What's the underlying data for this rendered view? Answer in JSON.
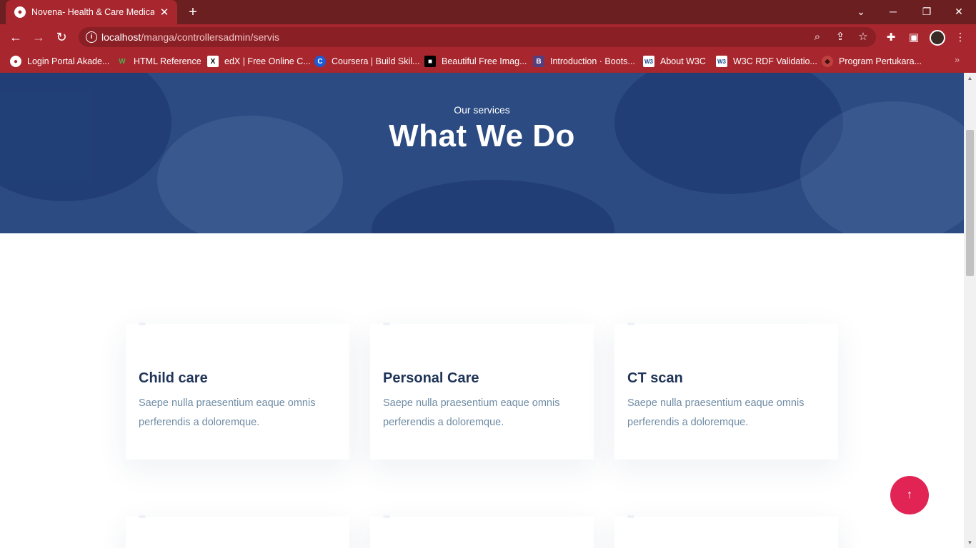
{
  "browser": {
    "tab_title": "Novena- Health & Care Medical t",
    "url_host": "localhost",
    "url_path": "/manga/controllersadmin/servis",
    "bookmarks": [
      {
        "label": "Login Portal Akade...",
        "icon": "portal-icon"
      },
      {
        "label": "HTML Reference",
        "icon": "w-icon"
      },
      {
        "label": "edX | Free Online C...",
        "icon": "edx-icon"
      },
      {
        "label": "Coursera | Build Skil...",
        "icon": "coursera-icon"
      },
      {
        "label": "Beautiful Free Imag...",
        "icon": "unsplash-icon"
      },
      {
        "label": "Introduction · Boots...",
        "icon": "bootstrap-icon"
      },
      {
        "label": "About W3C",
        "icon": "w3c-icon"
      },
      {
        "label": "W3C RDF Validatio...",
        "icon": "w3c-icon"
      },
      {
        "label": "Program Pertukara...",
        "icon": "program-icon"
      }
    ]
  },
  "hero": {
    "subtitle": "Our services",
    "title": "What We Do"
  },
  "services": [
    {
      "title": "Child care",
      "text": "Saepe nulla praesentium eaque omnis perferendis a doloremque."
    },
    {
      "title": "Personal Care",
      "text": "Saepe nulla praesentium eaque omnis perferendis a doloremque."
    },
    {
      "title": "CT scan",
      "text": "Saepe nulla praesentium eaque omnis perferendis a doloremque."
    }
  ],
  "back_to_top": {
    "icon": "arrow-up-icon",
    "glyph": "↑"
  },
  "colors": {
    "chrome_dark": "#6b1f20",
    "chrome": "#a8262d",
    "hero_bg": "#2b4b82",
    "heading": "#1f3458",
    "body_text": "#6f8ba4",
    "accent": "#e12454"
  }
}
